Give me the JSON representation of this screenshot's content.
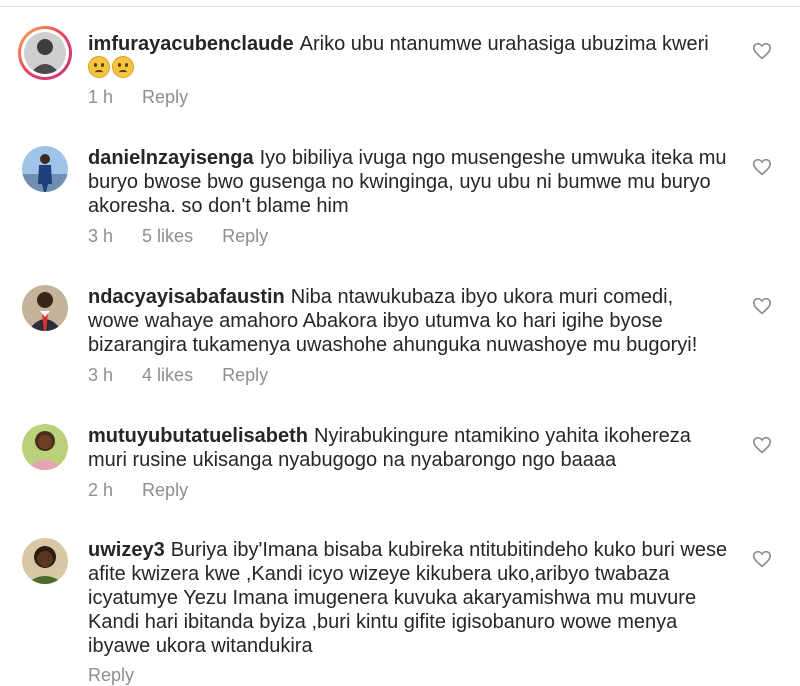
{
  "comments": [
    {
      "username": "imfurayacubenclaude",
      "text": "Ariko ubu ntanumwe  urahasiga ubuzima kweri",
      "emojis": [
        "crying-face",
        "crying-face"
      ],
      "time": "1 h",
      "likes": "",
      "reply": "Reply"
    },
    {
      "username": "danielnzayisenga",
      "text": "Iyo bibiliya ivuga ngo musengeshe umwuka iteka mu buryo bwose bwo gusenga no kwinginga, uyu ubu ni bumwe mu buryo akoresha.  so don't blame him",
      "time": "3 h",
      "likes": "5 likes",
      "reply": "Reply"
    },
    {
      "username": "ndacyayisabafaustin",
      "text": "Niba ntawukubaza ibyo ukora muri comedi, wowe wahaye amahoro Abakora ibyo utumva ko hari igihe byose bizarangira tukamenya uwashohe ahunguka nuwashoye mu bugoryi!",
      "time": "3 h",
      "likes": "4 likes",
      "reply": "Reply"
    },
    {
      "username": "mutuyubutatuelisabeth",
      "text": "Nyirabukingure ntamikino yahita ikohereza muri rusine ukisanga nyabugogo na nyabarongo ngo baaaa",
      "time": "2 h",
      "likes": "",
      "reply": "Reply"
    },
    {
      "username": "uwizey3",
      "text": "Buriya iby'Imana bisaba kubireka ntitubitindeho kuko buri wese afite kwizera kwe ,Kandi icyo wizeye kikubera uko,aribyo twabaza icyatumye Yezu Imana imugenera kuvuka akaryamishwa mu muvure Kandi hari ibitanda byiza ,buri kintu gifite igisobanuro wowe menya ibyawe ukora witandukira",
      "time": "",
      "likes": "",
      "reply": "Reply"
    }
  ],
  "colors": {
    "text": "#262626",
    "meta": "#8e8e8e",
    "divider": "#dbdbdb",
    "story_ring": "#e8425e"
  },
  "icons": {
    "like": "heart-outline-icon"
  }
}
